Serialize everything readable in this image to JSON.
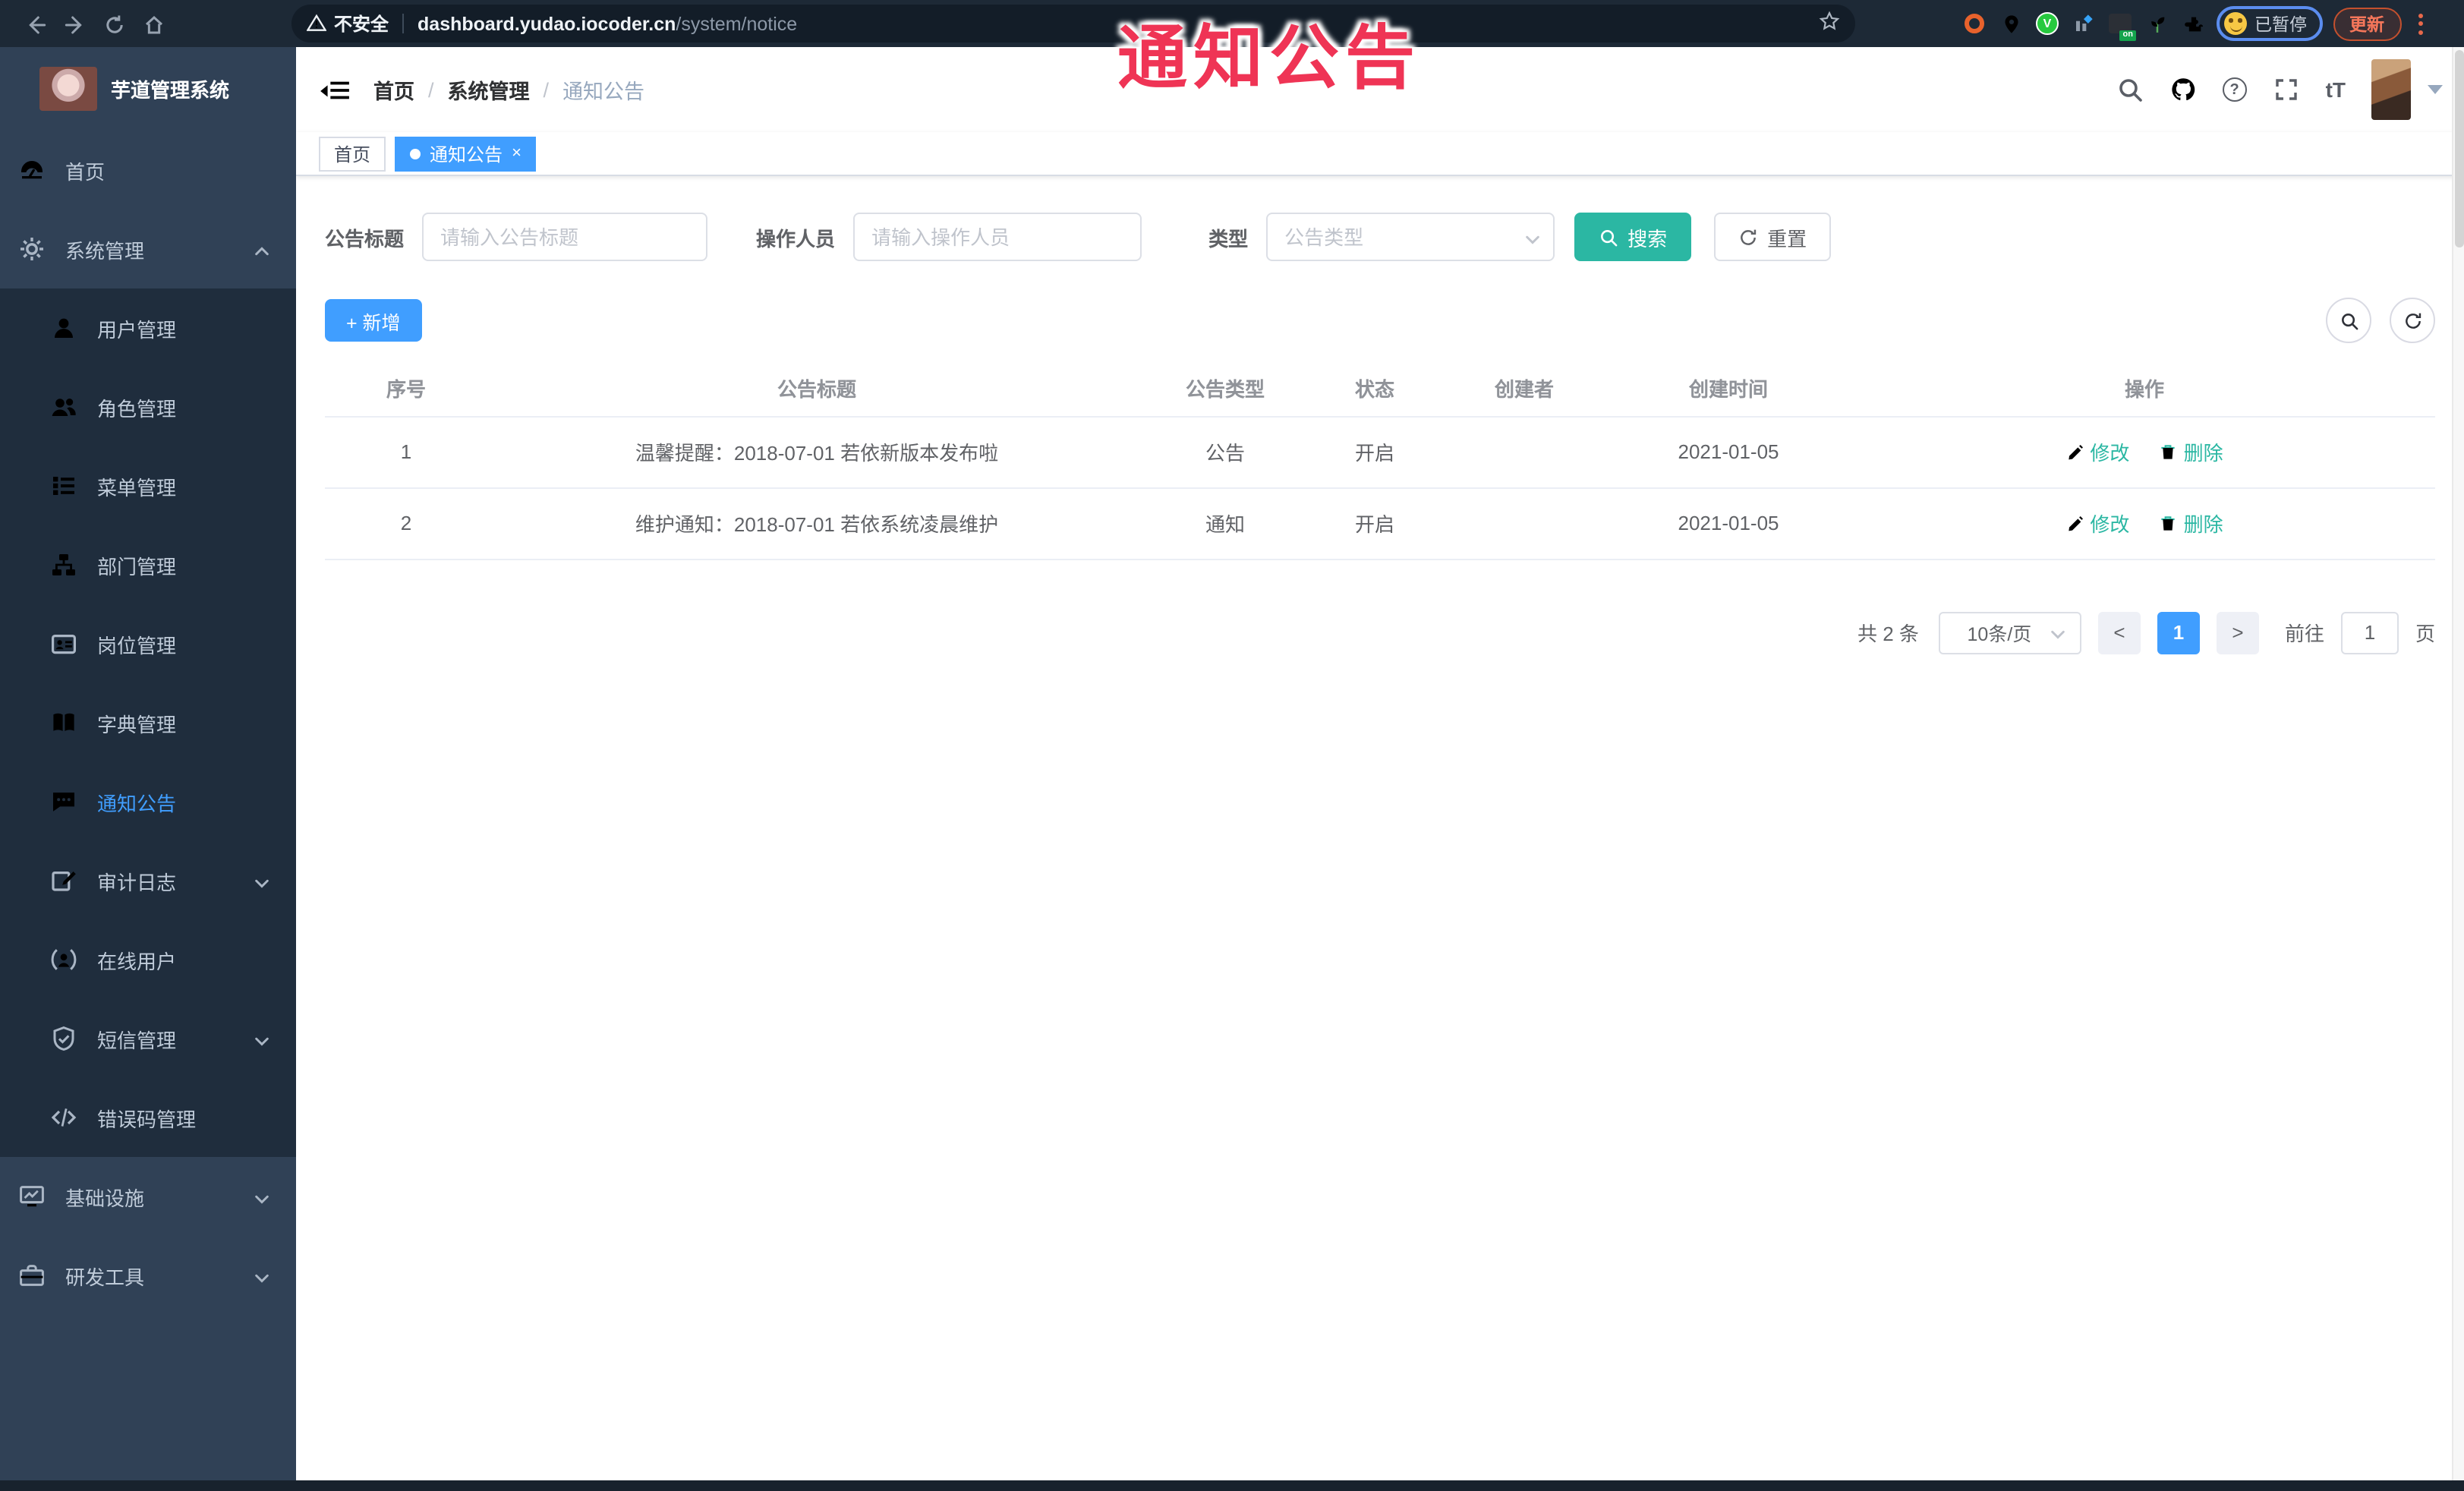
{
  "watermark": "通知公告",
  "colors": {
    "primary_blue": "#409eff",
    "teal_accent": "#2bb7a3",
    "sidebar_bg": "#304156",
    "submenu_bg": "#1f2d3d",
    "sidebar_active": "#409eff",
    "chrome_bg": "#1d2936",
    "watermark_red": "#ef3455"
  },
  "browser": {
    "security_label": "不安全",
    "url_host": "dashboard.yudao.iocoder.cn",
    "url_path": "/system/notice",
    "ext_v_label": "V",
    "ext_on_label": "on",
    "paused_label": "已暂停",
    "update_label": "更新"
  },
  "sidebar": {
    "title": "芋道管理系统",
    "top_items": [
      {
        "label": "首页"
      },
      {
        "label": "系统管理"
      }
    ],
    "sub_items": [
      {
        "label": "用户管理"
      },
      {
        "label": "角色管理"
      },
      {
        "label": "菜单管理"
      },
      {
        "label": "部门管理"
      },
      {
        "label": "岗位管理"
      },
      {
        "label": "字典管理"
      },
      {
        "label": "通知公告"
      },
      {
        "label": "审计日志"
      },
      {
        "label": "在线用户"
      },
      {
        "label": "短信管理"
      },
      {
        "label": "错误码管理"
      }
    ],
    "bottom_items": [
      {
        "label": "基础设施"
      },
      {
        "label": "研发工具"
      }
    ]
  },
  "navbar": {
    "breadcrumb": [
      "首页",
      "系统管理",
      "通知公告"
    ],
    "separator": "/",
    "font_icon_text": "tT",
    "help_icon_text": "?"
  },
  "tabs": [
    {
      "label": "首页"
    },
    {
      "label": "通知公告",
      "close": "×"
    }
  ],
  "filters": {
    "title_label": "公告标题",
    "title_placeholder": "请输入公告标题",
    "operator_label": "操作人员",
    "operator_placeholder": "请输入操作人员",
    "type_label": "类型",
    "type_placeholder": "公告类型",
    "search_label": "搜索",
    "reset_label": "重置"
  },
  "toolbar": {
    "add_label": "+ 新增"
  },
  "table": {
    "headers": [
      "序号",
      "公告标题",
      "公告类型",
      "状态",
      "创建者",
      "创建时间",
      "操作"
    ],
    "rows": [
      {
        "no": "1",
        "title": "温馨提醒：2018-07-01 若依新版本发布啦",
        "type": "公告",
        "status": "开启",
        "creator": "",
        "created": "2021-01-05",
        "edit": "修改",
        "delete": "删除"
      },
      {
        "no": "2",
        "title": "维护通知：2018-07-01 若依系统凌晨维护",
        "type": "通知",
        "status": "开启",
        "creator": "",
        "created": "2021-01-05",
        "edit": "修改",
        "delete": "删除"
      }
    ]
  },
  "pagination": {
    "total": "共 2 条",
    "page_size": "10条/页",
    "prev": "<",
    "next": ">",
    "current": "1",
    "goto_label": "前往",
    "goto_value": "1",
    "page_label": "页"
  },
  "icons": {
    "sidebar": [
      "dashboard-icon",
      "gear-icon",
      "user-icon",
      "users-icon",
      "list-icon",
      "tree-icon",
      "badge-icon",
      "book-icon",
      "chat-icon",
      "edit-log-icon",
      "online-users-icon",
      "shield-icon",
      "code-icon",
      "monitor-icon",
      "toolbox-icon"
    ],
    "navbar": [
      "search-icon",
      "github-icon",
      "help-icon",
      "fullscreen-icon",
      "font-size-icon",
      "avatar",
      "caret-down-icon"
    ],
    "browser": [
      "back-icon",
      "forward-icon",
      "reload-icon",
      "home-icon",
      "warning-icon",
      "star-icon",
      "extension-icons"
    ]
  }
}
